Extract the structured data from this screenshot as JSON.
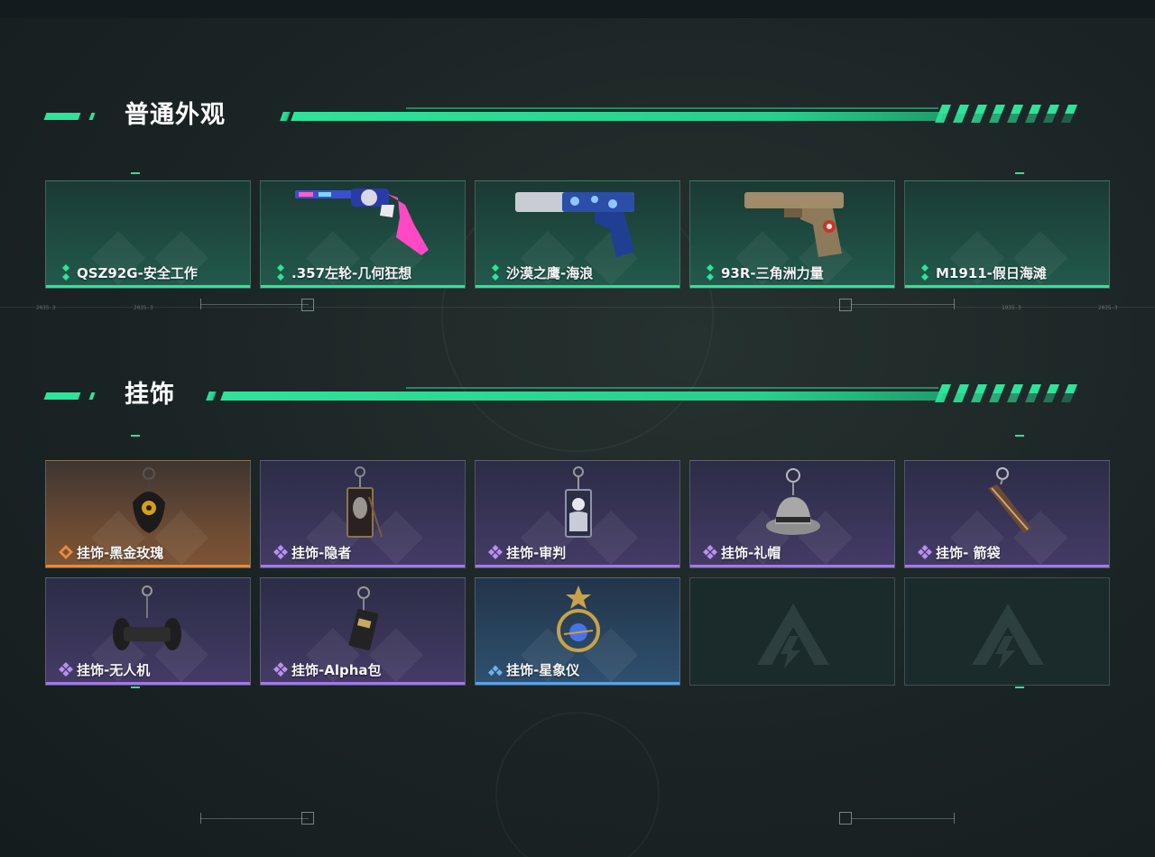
{
  "sections": [
    {
      "title": "普通外观",
      "items": [
        {
          "label": "QSZ92G-安全工作",
          "rarity": "green",
          "icon": "none"
        },
        {
          "label": ".357左轮-几何狂想",
          "rarity": "green",
          "icon": "revolver-skin"
        },
        {
          "label": "沙漠之鹰-海浪",
          "rarity": "green",
          "icon": "desert-eagle-skin"
        },
        {
          "label": "93R-三角洲力量",
          "rarity": "green",
          "icon": "pistol-93r-skin"
        },
        {
          "label": "M1911-假日海滩",
          "rarity": "green",
          "icon": "none"
        }
      ]
    },
    {
      "title": "挂饰",
      "items": [
        {
          "label": "挂饰-黑金玫瑰",
          "rarity": "orange",
          "icon": "black-gold-rose-charm"
        },
        {
          "label": "挂饰-隐者",
          "rarity": "purple",
          "icon": "hermit-card-charm"
        },
        {
          "label": "挂饰-审判",
          "rarity": "purple",
          "icon": "judgement-card-charm"
        },
        {
          "label": "挂饰-礼帽",
          "rarity": "purple",
          "icon": "fedora-hat-charm"
        },
        {
          "label": "挂饰- 箭袋",
          "rarity": "purple",
          "icon": "quiver-charm"
        },
        {
          "label": "挂饰-无人机",
          "rarity": "purple",
          "icon": "drone-charm"
        },
        {
          "label": "挂饰-Alpha包",
          "rarity": "purple",
          "icon": "alpha-bag-charm"
        },
        {
          "label": "挂饰-星象仪",
          "rarity": "blue",
          "icon": "astrolabe-charm"
        },
        {
          "label": "",
          "rarity": "empty",
          "icon": "game-logo"
        },
        {
          "label": "",
          "rarity": "empty",
          "icon": "game-logo"
        }
      ]
    }
  ],
  "colors": {
    "accent_green": "#2ee39a",
    "rarity_purple": "#a07ae6",
    "rarity_orange": "#e88a3a",
    "rarity_blue": "#5aa0e6"
  },
  "deco_text": [
    "2035-3",
    "2035-3",
    "1935-3",
    "2035-3"
  ]
}
